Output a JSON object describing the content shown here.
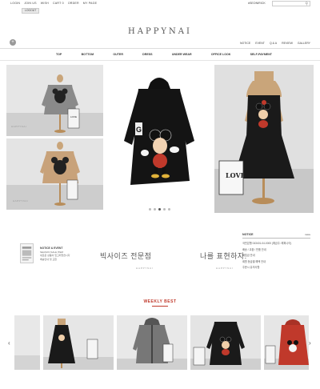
{
  "topbar": {
    "links": [
      "LOGIN",
      "JOIN US",
      "WISH",
      "CART",
      "ORDER",
      "MY PAGE"
    ],
    "cart_count": "0",
    "logout_label": "LOGOUT",
    "hash_label": "#SEONIRICK",
    "search_placeholder": ""
  },
  "header": {
    "logo": "HAPPYNAI",
    "subnav": [
      "NOTICE",
      "EVENT",
      "Q & A",
      "REVIEW",
      "GALLERY"
    ]
  },
  "categories": [
    "TOP",
    "BOTTOM",
    "OUTER",
    "DRESS",
    "UNDER WEAR",
    "OFFICE LOOK",
    "SELF-PAYMENT"
  ],
  "gallery": {
    "watermark": "HAPPYNAI",
    "love_sign": "LOVE",
    "slider_dots": 5,
    "active_dot": 3
  },
  "info": {
    "notice_lines": [
      "NOTICE & EVENT",
      "SEASON SALE ITEM",
      "새로운 상품이 입고되었습니다",
      "배송안내 및 교환"
    ],
    "banner1": "빅사이즈 전문점",
    "banner1_sub": "HAPPYNAI",
    "banner2": "나를 표현하자.",
    "banner2_sub": "HAPPYNAI"
  },
  "board": {
    "title": "NOTICE",
    "more": "more",
    "items": [
      "국민은행 043401-04-0000 (예금주: 해피나이)",
      "배송 / 교환 / 반품 안내",
      "적립금 안내",
      "회원 등급별 혜택 안내",
      "주문시 유의사항"
    ]
  },
  "weekly": {
    "title": "WEEKLY BEST",
    "prev": "‹",
    "next": "›"
  },
  "colors": {
    "accent": "#c0392b",
    "text": "#333333",
    "line": "#dddddd"
  }
}
